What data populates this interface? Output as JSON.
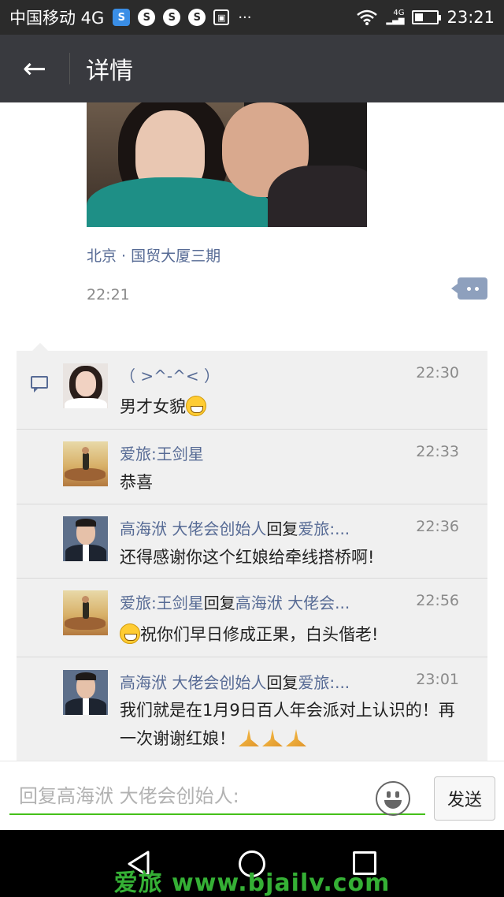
{
  "status_bar": {
    "carrier": "中国移动 4G",
    "icons": [
      "s-app-icon",
      "s-icon",
      "s-icon",
      "s-icon",
      "image-icon",
      "more-dots-icon"
    ],
    "network": "4G",
    "time": "23:21"
  },
  "title_bar": {
    "back_icon": "←",
    "title": "详情"
  },
  "post": {
    "location": "北京 · 国贸大厦三期",
    "time": "22:21"
  },
  "comments": [
    {
      "name": "（ >^-^< ）",
      "reply_word": "",
      "reply_to": "",
      "time": "22:30",
      "text": "男才女貌"
    },
    {
      "name": "爱旅:王剑星",
      "reply_word": "",
      "reply_to": "",
      "time": "22:33",
      "text": "恭喜"
    },
    {
      "name": "高海洑 大佬会创始人",
      "reply_word": "回复",
      "reply_to": "爱旅:...",
      "time": "22:36",
      "text": "还得感谢你这个红娘给牵线搭桥啊!"
    },
    {
      "name": "爱旅:王剑星",
      "reply_word": "回复",
      "reply_to": "高海洑 大佬会...",
      "time": "22:56",
      "text": "祝你们早日修成正果，白头偕老!"
    },
    {
      "name": "高海洑 大佬会创始人",
      "reply_word": "回复",
      "reply_to": "爱旅:...",
      "time": "23:01",
      "text": "我们就是在1月9日百人年会派对上认识的！再一次谢谢红娘！"
    }
  ],
  "reply_bar": {
    "placeholder": "回复高海洑 大佬会创始人:",
    "send_label": "发送"
  },
  "watermark": "爱旅 www.bjailv.com"
}
